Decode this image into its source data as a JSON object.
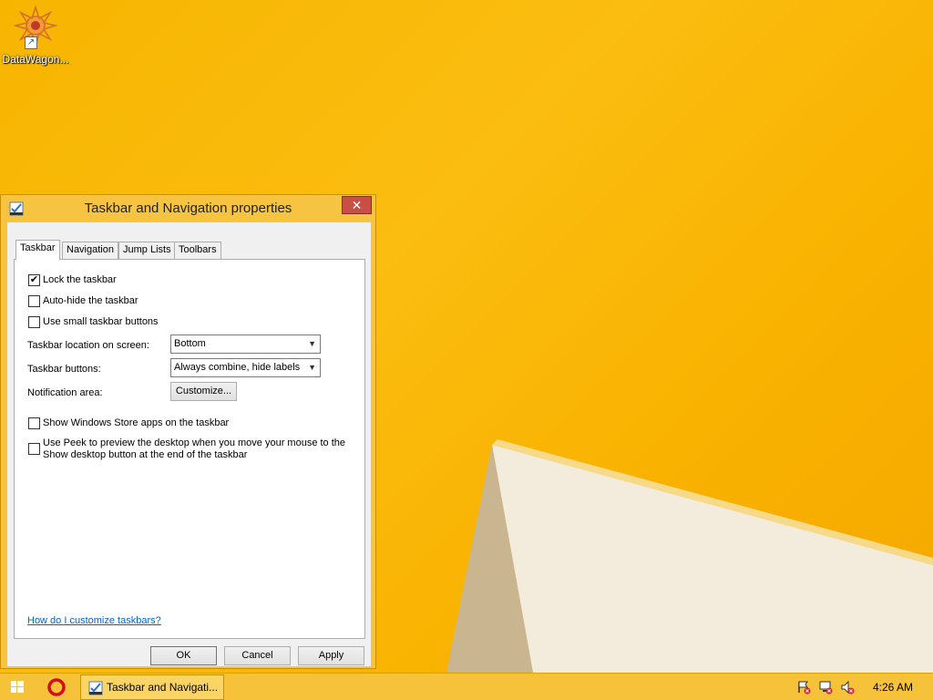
{
  "desktop": {
    "icon_label": "DataWagon...",
    "icon_name": "datawagon-icon"
  },
  "dialog": {
    "title": "Taskbar and Navigation properties",
    "close_glyph": "✕",
    "tabs": [
      {
        "label": "Taskbar",
        "active": true
      },
      {
        "label": "Navigation",
        "active": false
      },
      {
        "label": "Jump Lists",
        "active": false
      },
      {
        "label": "Toolbars",
        "active": false
      }
    ],
    "checks": {
      "lock": {
        "label": "Lock the taskbar",
        "checked": true
      },
      "autohide": {
        "label": "Auto-hide the taskbar",
        "checked": false
      },
      "small": {
        "label": "Use small taskbar buttons",
        "checked": false
      },
      "store": {
        "label": "Show Windows Store apps on the taskbar",
        "checked": false
      },
      "peek": {
        "label_line1": "Use Peek to preview the desktop when you move your mouse to the",
        "label_line2": "Show desktop button at the end of the taskbar",
        "checked": false
      }
    },
    "location_label": "Taskbar location on screen:",
    "location_value": "Bottom",
    "buttons_label": "Taskbar buttons:",
    "buttons_value": "Always combine, hide labels",
    "notification_label": "Notification area:",
    "customize_label": "Customize...",
    "help_link": "How do I customize taskbars?",
    "ok_label": "OK",
    "cancel_label": "Cancel",
    "apply_label": "Apply",
    "check_glyph": "✔"
  },
  "taskbar": {
    "active_window_label": "Taskbar and Navigati...",
    "clock": "4:26 AM"
  },
  "colors": {
    "wallpaper": "#f9b700",
    "dialog_frame": "#f6c440",
    "close_button": "#c74f46",
    "link": "#0066cc"
  }
}
